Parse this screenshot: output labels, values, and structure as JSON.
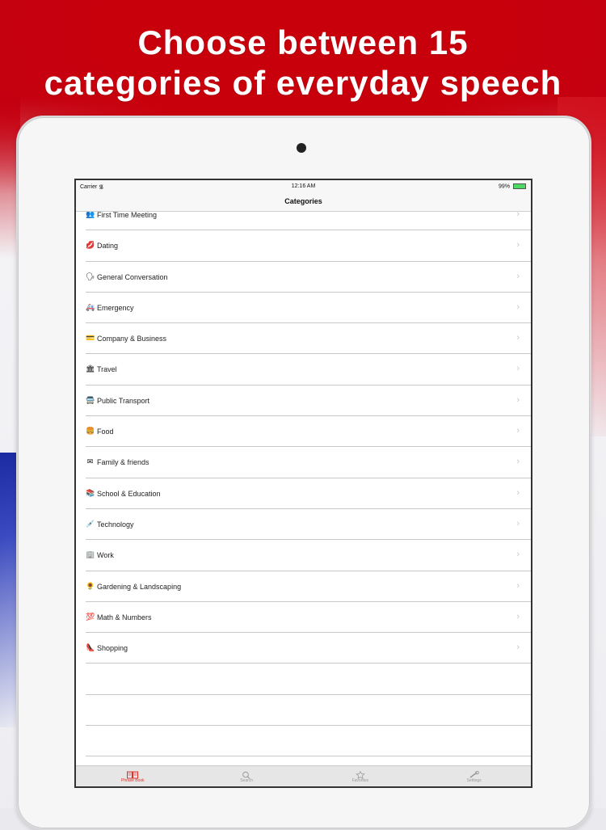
{
  "promo": {
    "headline_line1": "Choose between 15",
    "headline_line2": "categories of everyday speech"
  },
  "status_bar": {
    "carrier": "Carrier",
    "time": "12:16 AM",
    "battery": "99%"
  },
  "nav": {
    "title": "Categories"
  },
  "categories": [
    {
      "icon": "people-icon",
      "glyph": "👥",
      "label": "First Time Meeting"
    },
    {
      "icon": "lips-icon",
      "glyph": "💋",
      "label": "Dating"
    },
    {
      "icon": "speaking-head-icon",
      "glyph": "🗣",
      "label": "General Conversation"
    },
    {
      "icon": "ambulance-icon",
      "glyph": "🚑",
      "label": "Emergency"
    },
    {
      "icon": "credit-card-icon",
      "glyph": "💳",
      "label": "Company & Business"
    },
    {
      "icon": "classical-building-icon",
      "glyph": "🏛",
      "label": "Travel"
    },
    {
      "icon": "bus-icon",
      "glyph": "🚍",
      "label": "Public Transport"
    },
    {
      "icon": "hamburger-icon",
      "glyph": "🍔",
      "label": "Food"
    },
    {
      "icon": "envelope-icon",
      "glyph": "✉",
      "label": "Family & friends"
    },
    {
      "icon": "books-icon",
      "glyph": "📚",
      "label": "School & Education"
    },
    {
      "icon": "syringe-icon",
      "glyph": "💉",
      "label": "Technology"
    },
    {
      "icon": "office-building-icon",
      "glyph": "🏢",
      "label": "Work"
    },
    {
      "icon": "sunflower-icon",
      "glyph": "🌻",
      "label": "Gardening & Landscaping"
    },
    {
      "icon": "hundred-points-icon",
      "glyph": "💯",
      "label": "Math & Numbers"
    },
    {
      "icon": "high-heel-icon",
      "glyph": "👠",
      "label": "Shopping"
    }
  ],
  "tabs": [
    {
      "icon": "book-icon",
      "label": "Phrase Book",
      "active": true
    },
    {
      "icon": "search-icon",
      "label": "Search",
      "active": false
    },
    {
      "icon": "favorites-icon",
      "label": "Favorites",
      "active": false
    },
    {
      "icon": "settings-icon",
      "label": "Settings",
      "active": false
    }
  ],
  "colors": {
    "brand_red": "#c40010",
    "tab_active": "#e0302a",
    "separator": "#c8c7cc"
  }
}
